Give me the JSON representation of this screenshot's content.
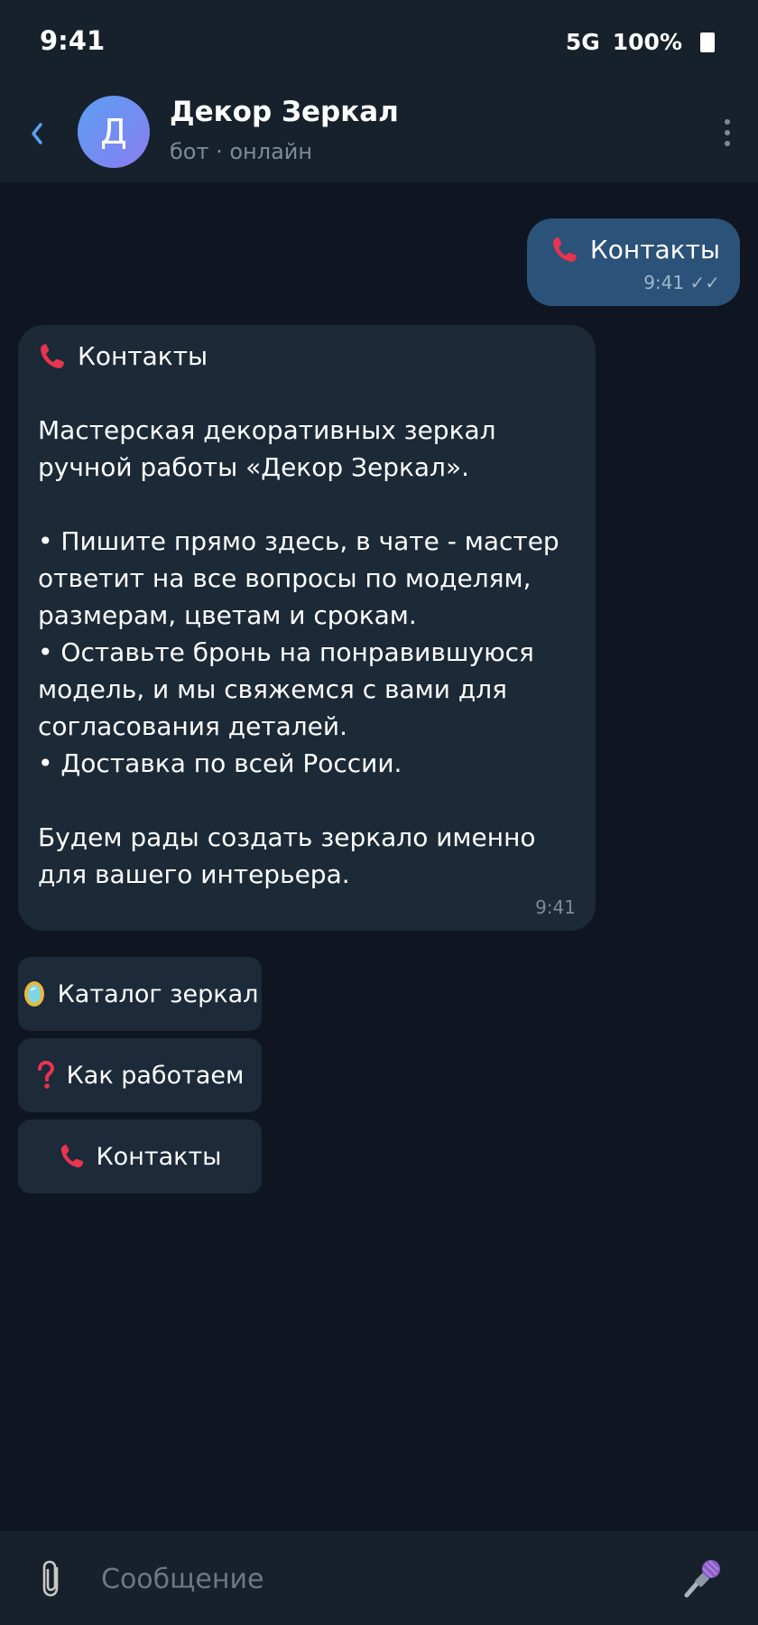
{
  "status": {
    "time": "9:41",
    "network": "5G",
    "battery": "100%"
  },
  "header": {
    "avatar_letter": "Д",
    "title": "Декор Зеркал",
    "subtitle": "бот · онлайн"
  },
  "outgoing_message": {
    "text": "Контакты",
    "time": "9:41",
    "ticks": "✓✓"
  },
  "incoming_message": {
    "heading": "Контакты",
    "paragraph_1": "Мастерская декоративных зеркал ручной работы «Декор Зеркал».",
    "bullet_1": "• Пишите прямо здесь, в чате - мастер ответит на все вопросы по моделям, размерам, цветам и срокам.",
    "bullet_2": "• Оставьте бронь на понравившуюся модель, и мы свяжемся с вами для согласования деталей.",
    "bullet_3": "• Доставка по всей России.",
    "paragraph_2": "Будем рады создать зеркало именно для вашего интерьера.",
    "time": "9:41"
  },
  "keyboard": {
    "buttons": [
      {
        "label": "Каталог зеркал",
        "icon": "mirror-icon"
      },
      {
        "label": "Как работаем",
        "icon": "question-icon"
      },
      {
        "label": "Контакты",
        "icon": "phone-icon"
      }
    ]
  },
  "input": {
    "placeholder": "Сообщение"
  },
  "colors": {
    "background": "#0f1621",
    "bar": "#17212b",
    "outgoing_bubble": "#2b5278",
    "incoming_bubble": "#1c2937",
    "accent": "#5aa0f2",
    "phone_red": "#e8344e"
  }
}
